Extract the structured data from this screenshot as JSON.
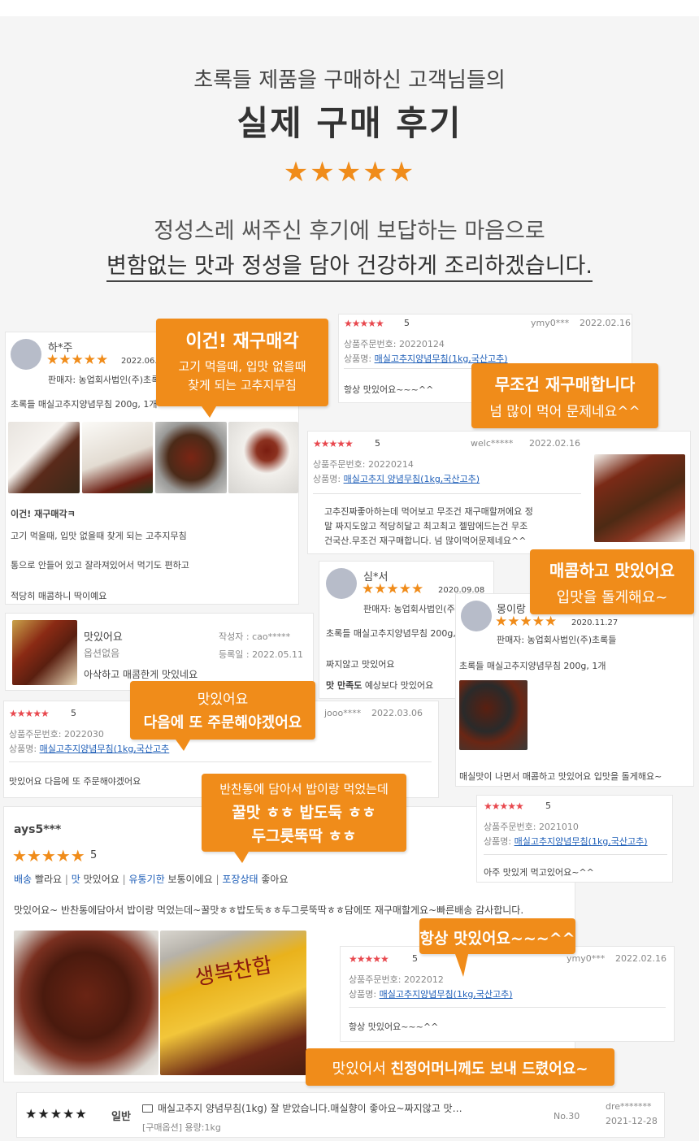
{
  "header": {
    "line1": "초록들 제품을 구매하신 고객님들의",
    "title": "실제 구매 후기",
    "stars": "★★★★★",
    "line2": "정성스레 써주신 후기에 보답하는 마음으로",
    "line3": "변함없는 맛과 정성을 담아 건강하게 조리하겠습니다."
  },
  "card1": {
    "name": "하*주",
    "stars": "★★★★★",
    "date": "2022.06.1",
    "seller": "판매자: 농업회사법인(주)초록",
    "product": "초록들 매실고추지양념무침 200g, 1개",
    "bold": "이건! 재구매각ㅋ",
    "t1": "고기 먹을때, 입맛 없을때 찾게 되는 고추지무침",
    "t2": "통으로 안들어 있고 잘라져있어서 먹기도 편하고",
    "t3": "적당히 매콤하니 딱이예요"
  },
  "bubble1": {
    "title": "이건! 재구매각",
    "l1": "고기 먹을때, 입맛 없을때",
    "l2": "찾게 되는 고추지무침"
  },
  "card2": {
    "stars": "★★★★★",
    "score": "5",
    "user": "ymy0***",
    "date": "2022.02.16",
    "order_label": "상품주문번호:",
    "order": "20220124",
    "product_label": "상품명:",
    "product": "매실고추지양념무침(1kg,국산고추)",
    "text": "항상 맛있어요~~~^^"
  },
  "bubble2": {
    "l1": "무조건 재구매합니다",
    "l2": "넘 많이 먹어 문제네요^^"
  },
  "card3": {
    "stars": "★★★★★",
    "score": "5",
    "user": "welc*****",
    "date": "2022.02.16",
    "order_label": "상품주문번호:",
    "order": "20220214",
    "product_label": "상품명:",
    "product": "매실고추지 양념무침(1kg,국산고추)",
    "t1": "고추진짜좋아하는데 먹어보고 무조건 재구매할꺼에요 정",
    "t2": "말 짜지도않고 적당히달고 최고최고 젤맘에드는건 무조",
    "t3": "건국산.무조건 재구매합니다. 넘 많이먹어문제네요^^"
  },
  "card4": {
    "title": "맛있어요",
    "option": "옵션없음",
    "author_label": "작성자 :",
    "author": "cao*****",
    "date_label": "등록일 :",
    "date": "2022.05.11",
    "text": "아삭하고 매콤한게 맛있네요"
  },
  "card5": {
    "name": "심*서",
    "stars": "★★★★★",
    "date": "2020.09.08",
    "seller": "판매자: 농업회사법인(주",
    "product": "초록들 매실고추지양념무침 200g,",
    "t1": "짜지않고 맛있어요",
    "tag": "맛 만족도",
    "tagval": "예상보다 맛있어요"
  },
  "card6": {
    "name": "몽이랑",
    "stars": "★★★★★",
    "date": "2020.11.27",
    "seller": "판매자: 농업회사법인(주)초록들",
    "product": "초록들 매실고추지양념무침 200g, 1개",
    "text": "매실맛이 나면서 매콤하고 맛있어요 입맛을 돌게해요~"
  },
  "bubble3": {
    "l1": "매콤하고 맛있어요",
    "l2": "입맛을 돌게해요~"
  },
  "card7": {
    "stars": "★★★★★",
    "score": "5",
    "user": "jooo****",
    "date": "2022.03.06",
    "order_label": "상품주문번호:",
    "order": "2022030",
    "product_label": "상품명:",
    "product": "매실고추지양념무침(1kg,국산고추",
    "text": "맛있어요 다음에 또 주문해야겠어요"
  },
  "bubble4": {
    "l1": "맛있어요",
    "l2": "다음에 또 주문해야겠어요"
  },
  "bubble5": {
    "l1": "반찬통에 담아서 밥이랑 먹었는데",
    "l2": "꿀맛 ㅎㅎ 밥도둑 ㅎㅎ",
    "l3": "두그릇뚝딱 ㅎㅎ"
  },
  "card8": {
    "user": "ays5***",
    "stars": "★★★★★",
    "score": "5",
    "tabs": [
      {
        "k": "배송",
        "v": "빨라요"
      },
      {
        "k": "맛",
        "v": "맛있어요"
      },
      {
        "k": "유통기한",
        "v": "보통이에요"
      },
      {
        "k": "포장상태",
        "v": "좋아요"
      }
    ],
    "text": "맛있어요~ 반찬통에담아서 밥이랑 먹었는데~꿀맛ㅎㅎ밥도둑ㅎㅎ두그릇뚝딱ㅎㅎ담에또 재구매할게요~빠른배송 감사합니다.",
    "pkg": "생복찬합"
  },
  "card9": {
    "stars": "★★★★★",
    "score": "5",
    "order_label": "상품주문번호:",
    "order": "2021010",
    "product_label": "상품명:",
    "product": "매실고추지양념무침(1kg,국산고추)",
    "text": "아주 맛있게 먹고있어요~^^"
  },
  "card10": {
    "stars": "★★★★★",
    "score": "5",
    "user": "ymy0***",
    "date": "2022.02.16",
    "order_label": "상품주문번호:",
    "order": "2022012",
    "product_label": "상품명:",
    "product": "매실고추지양념무침(1kg,국산고추)",
    "text": "항상 맛있어요~~~^^"
  },
  "bubble6": {
    "l1": "항상 맛있어요~~~^^"
  },
  "bubble7": {
    "pre": "맛있어서 ",
    "bold": "친정어머니께도 보내 드렸어요~"
  },
  "card11": {
    "stars": "★★★★★",
    "type": "일반",
    "title": "매실고추지 양념무침(1kg) 잘 받았습니다.매실향이 좋아요~짜지않고 맛…",
    "option": "[구매옵션] 용량:1kg",
    "no": "No.30",
    "user": "dre*******",
    "date": "2021-12-28"
  },
  "colors": {
    "accent": "#f08c1a",
    "star_red": "#e8484e",
    "link": "#1f5fb8"
  }
}
